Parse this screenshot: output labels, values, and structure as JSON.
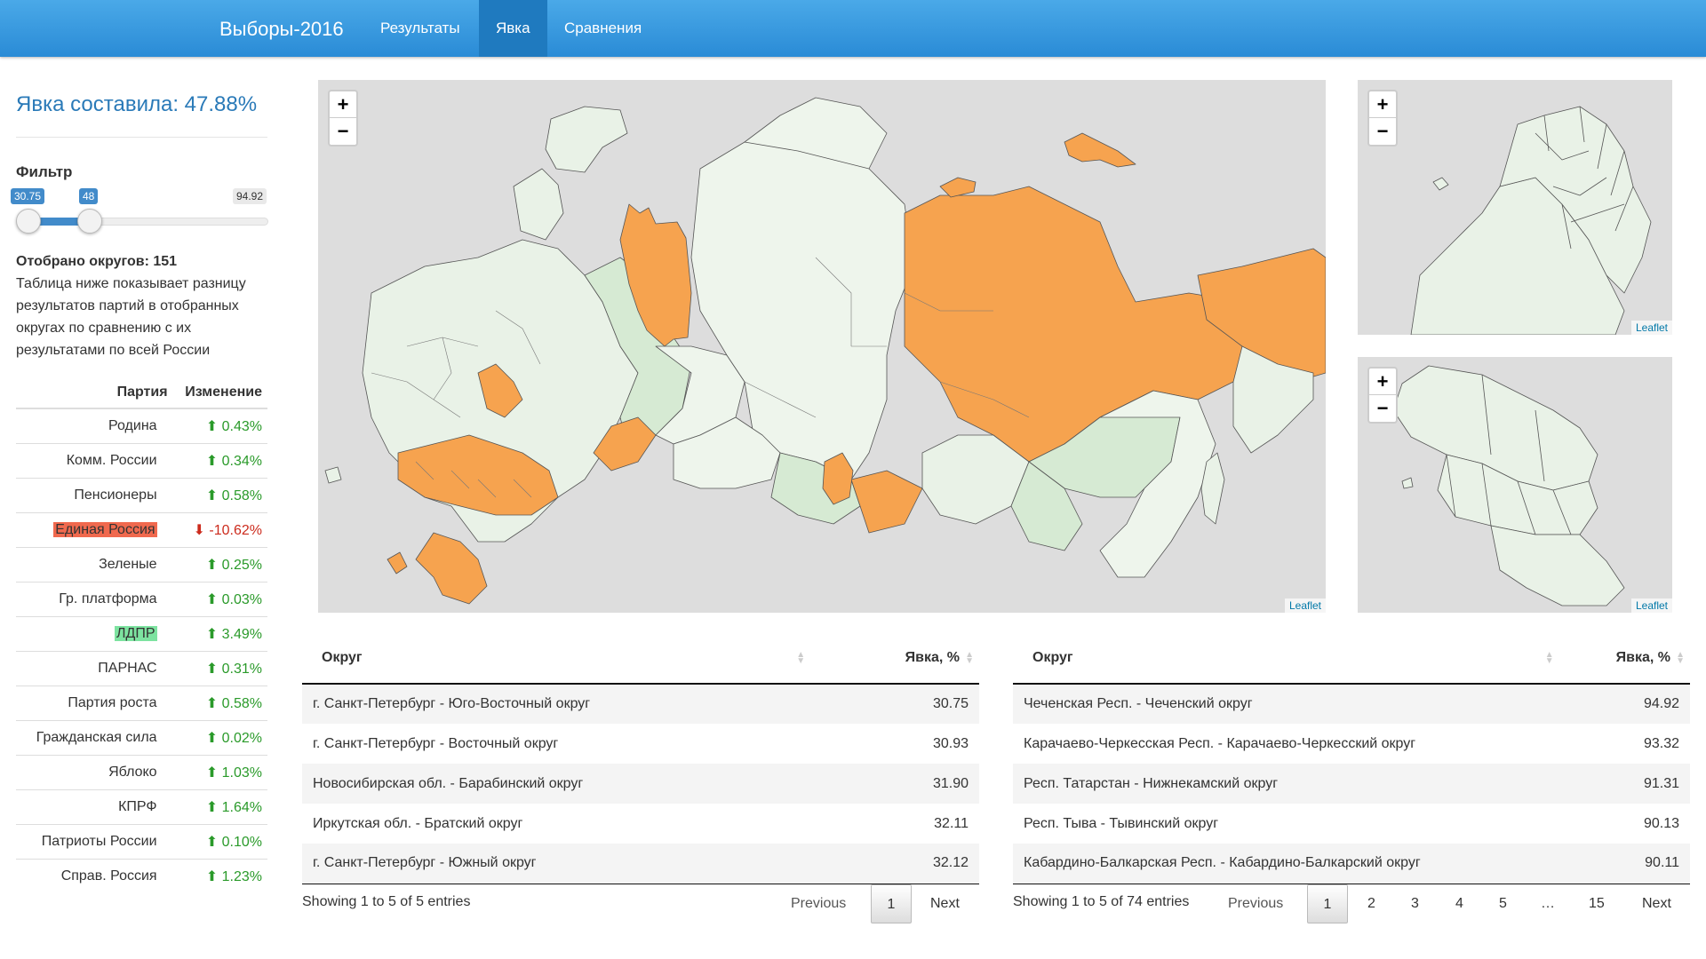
{
  "nav": {
    "brand": "Выборы-2016",
    "items": [
      {
        "label": "Результаты",
        "active": false
      },
      {
        "label": "Явка",
        "active": true
      },
      {
        "label": "Сравнения",
        "active": false
      }
    ]
  },
  "sidebar": {
    "turnout_title": "Явка составила: 47.88%",
    "filter_label": "Фильтр",
    "slider": {
      "min": "30.75",
      "value": "48",
      "max": "94.92",
      "range_min": 30.75,
      "range_max": 94.92,
      "selected": 48
    },
    "selected_count_label": "Отобрано округов: 151",
    "description": "Таблица ниже показывает разницу результатов партий в отобранных округах по сравнению с их результатами по всей России",
    "table_headers": {
      "party": "Партия",
      "change": "Изменение"
    },
    "parties": [
      {
        "name": "Родина",
        "change": "0.43%",
        "dir": "up",
        "highlight": ""
      },
      {
        "name": "Комм. России",
        "change": "0.34%",
        "dir": "up",
        "highlight": ""
      },
      {
        "name": "Пенсионеры",
        "change": "0.58%",
        "dir": "up",
        "highlight": ""
      },
      {
        "name": "Единая Россия",
        "change": "-10.62%",
        "dir": "down",
        "highlight": "red"
      },
      {
        "name": "Зеленые",
        "change": "0.25%",
        "dir": "up",
        "highlight": ""
      },
      {
        "name": "Гр. платформа",
        "change": "0.03%",
        "dir": "up",
        "highlight": ""
      },
      {
        "name": "ЛДПР",
        "change": "3.49%",
        "dir": "up",
        "highlight": "green"
      },
      {
        "name": "ПАРНАС",
        "change": "0.31%",
        "dir": "up",
        "highlight": ""
      },
      {
        "name": "Партия роста",
        "change": "0.58%",
        "dir": "up",
        "highlight": ""
      },
      {
        "name": "Гражданская сила",
        "change": "0.02%",
        "dir": "up",
        "highlight": ""
      },
      {
        "name": "Яблоко",
        "change": "1.03%",
        "dir": "up",
        "highlight": ""
      },
      {
        "name": "КПРФ",
        "change": "1.64%",
        "dir": "up",
        "highlight": ""
      },
      {
        "name": "Патриоты России",
        "change": "0.10%",
        "dir": "up",
        "highlight": ""
      },
      {
        "name": "Справ. Россия",
        "change": "1.23%",
        "dir": "up",
        "highlight": ""
      }
    ]
  },
  "maps": {
    "zoom_in": "+",
    "zoom_out": "−",
    "attribution": "Leaflet",
    "colors": {
      "selected": "#f6a34f",
      "default": "#e9f2e7",
      "light_green": "#cfe6cb",
      "background": "#dddddd"
    }
  },
  "table_low": {
    "headers": {
      "district": "Округ",
      "turnout": "Явка, %"
    },
    "rows": [
      {
        "district": "г. Санкт-Петербург - Юго-Восточный округ",
        "turnout": "30.75"
      },
      {
        "district": "г. Санкт-Петербург - Восточный округ",
        "turnout": "30.93"
      },
      {
        "district": "Новосибирская обл. - Барабинский округ",
        "turnout": "31.90"
      },
      {
        "district": "Иркутская обл. - Братский округ",
        "turnout": "32.11"
      },
      {
        "district": "г. Санкт-Петербург - Южный округ",
        "turnout": "32.12"
      }
    ],
    "info": "Showing 1 to 5 of 5 entries",
    "pagination": {
      "previous": "Previous",
      "current": "1",
      "next": "Next"
    }
  },
  "table_high": {
    "headers": {
      "district": "Округ",
      "turnout": "Явка, %"
    },
    "rows": [
      {
        "district": "Чеченская Респ. - Чеченский округ",
        "turnout": "94.92"
      },
      {
        "district": "Карачаево-Черкесская Респ. - Карачаево-Черкесский округ",
        "turnout": "93.32"
      },
      {
        "district": "Респ. Татарстан - Нижнекамский округ",
        "turnout": "91.31"
      },
      {
        "district": "Респ. Тыва - Тывинский округ",
        "turnout": "90.13"
      },
      {
        "district": "Кабардино-Балкарская Респ. - Кабардино-Балкарский округ",
        "turnout": "90.11"
      }
    ],
    "info": "Showing 1 to 5 of 74 entries",
    "pagination": {
      "previous": "Previous",
      "pages": [
        "1",
        "2",
        "3",
        "4",
        "5",
        "…",
        "15"
      ],
      "next": "Next"
    }
  }
}
